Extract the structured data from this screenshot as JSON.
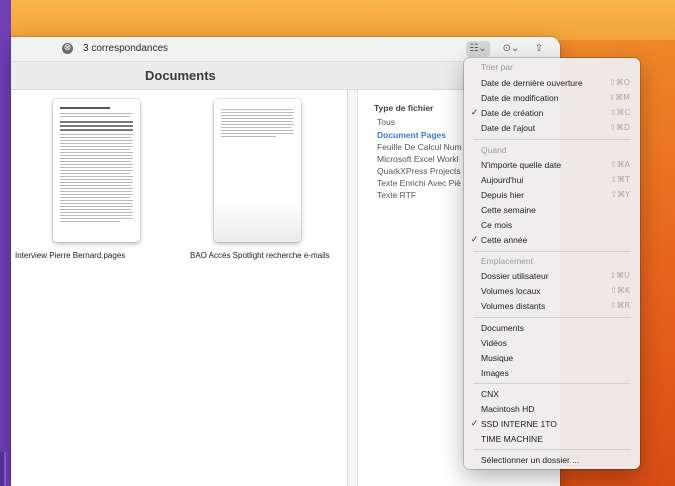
{
  "search": {
    "match_count": "3 correspondances",
    "clear_icon": "⊗"
  },
  "toolbar": {
    "sort_icon": "☷⌄",
    "more_icon": "⊙⌄",
    "share_icon": "⇧"
  },
  "window": {
    "title": "Documents"
  },
  "files": [
    {
      "name": "Interview Pierre Bernard.pages"
    },
    {
      "name": "BAO Accès Spotlight recherche e-mails"
    }
  ],
  "filters": {
    "title": "Type de fichier",
    "options": [
      "Tous",
      "Document Pages",
      "Feuille De Calcul Num",
      "Microsoft Excel Workl",
      "QuarkXPress Projects",
      "Texte Enrichi Avec Piè",
      "Texte RTF"
    ],
    "active": "Document Pages"
  },
  "menu": {
    "sort_header": "Trier par",
    "sort_items": [
      {
        "label": "Date de dernière ouverture",
        "shortcut": "⇧⌘O",
        "checked": false
      },
      {
        "label": "Date de modification",
        "shortcut": "⇧⌘M",
        "checked": false
      },
      {
        "label": "Date de création",
        "shortcut": "⇧⌘C",
        "checked": true
      },
      {
        "label": "Date de l'ajout",
        "shortcut": "⇧⌘D",
        "checked": false
      }
    ],
    "when_header": "Quand",
    "when_items": [
      {
        "label": "N'importe quelle date",
        "shortcut": "⇧⌘A",
        "checked": false
      },
      {
        "label": "Aujourd'hui",
        "shortcut": "⇧⌘T",
        "checked": false
      },
      {
        "label": "Depuis hier",
        "shortcut": "⇧⌘Y",
        "checked": false
      },
      {
        "label": "Cette semaine",
        "shortcut": "",
        "checked": false
      },
      {
        "label": "Ce mois",
        "shortcut": "",
        "checked": false
      },
      {
        "label": "Cette année",
        "shortcut": "",
        "checked": true
      }
    ],
    "location_header": "Emplacement",
    "location_items": [
      {
        "label": "Dossier utilisateur",
        "shortcut": "⇧⌘U"
      },
      {
        "label": "Volumes locaux",
        "shortcut": "⇧⌘K"
      },
      {
        "label": "Volumes distants",
        "shortcut": "⇧⌘R"
      }
    ],
    "folder_items": [
      "Documents",
      "Vidéos",
      "Musique",
      "Images"
    ],
    "volume_items": [
      {
        "label": "CNX",
        "checked": false
      },
      {
        "label": "Macintosh HD",
        "checked": false
      },
      {
        "label": "SSD INTERNE 1TO",
        "checked": true
      },
      {
        "label": "TIME MACHINE",
        "checked": false
      }
    ],
    "select_folder": "Sélectionner un dossier ...",
    "check_glyph": "✓"
  }
}
